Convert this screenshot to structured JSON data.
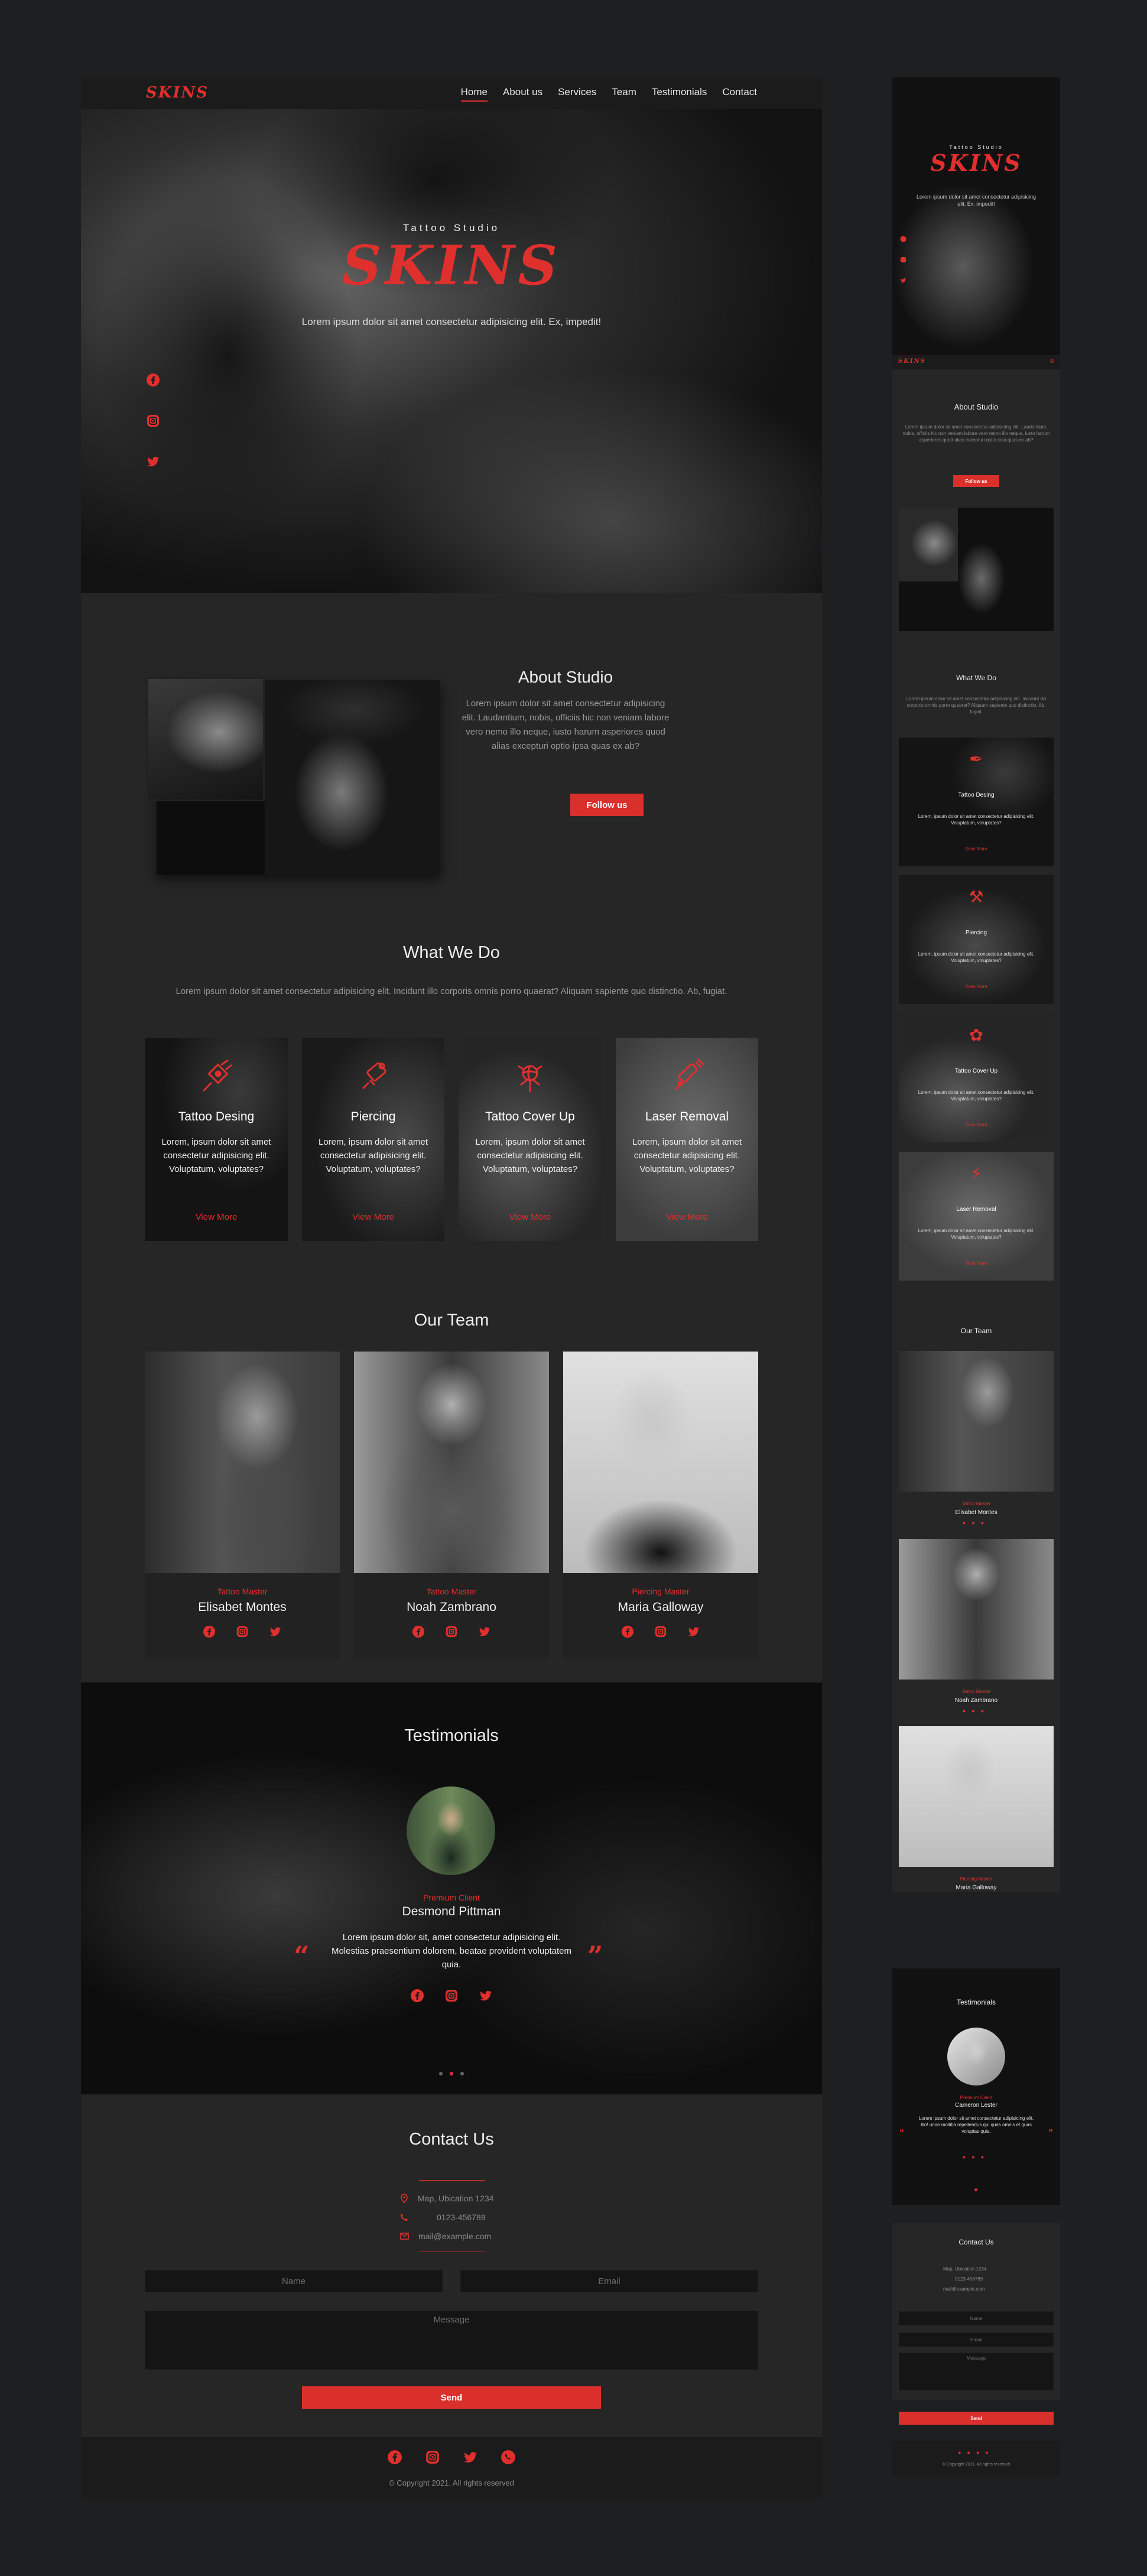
{
  "nav": {
    "logo": "SKINS",
    "items": [
      "Home",
      "About us",
      "Services",
      "Team",
      "Testimonials",
      "Contact"
    ]
  },
  "hero": {
    "kicker": "Tattoo Studio",
    "title": "SKINS",
    "subtitle": "Lorem ipsum dolor sit amet consectetur adipisicing elit. Ex, impedit!"
  },
  "about": {
    "title": "About Studio",
    "text": "Lorem ipsum dolor sit amet consectetur adipisicing elit. Laudantium, nobis, officiis hic non veniam labore vero nemo illo neque, iusto harum asperiores quod alias excepturi optio ipsa quas ex ab?",
    "button": "Follow us"
  },
  "services": {
    "title": "What We Do",
    "intro": "Lorem ipsum dolor sit amet consectetur adipisicing elit. Incidunt illo corporis omnis porro quaerat? Aliquam sapiente quo distinctio. Ab, fugiat.",
    "items": [
      {
        "title": "Tattoo Desing",
        "text": "Lorem, ipsum dolor sit amet consectetur adipisicing elit. Voluptatum, voluptates?",
        "link": "View More",
        "icon": "tattoo-machine-icon"
      },
      {
        "title": "Piercing",
        "text": "Lorem, ipsum dolor sit amet consectetur adipisicing elit. Voluptatum, voluptates?",
        "link": "View More",
        "icon": "piercing-gun-icon"
      },
      {
        "title": "Tattoo Cover Up",
        "text": "Lorem, ipsum dolor sit amet consectetur adipisicing elit. Voluptatum, voluptates?",
        "link": "View More",
        "icon": "rose-icon"
      },
      {
        "title": "Laser Removal",
        "text": "Lorem, ipsum dolor sit amet consectetur adipisicing elit. Voluptatum, voluptates?",
        "link": "View More",
        "icon": "laser-icon"
      }
    ]
  },
  "team": {
    "title": "Our Team",
    "members": [
      {
        "role": "Tattoo Master",
        "name": "Elisabet Montes"
      },
      {
        "role": "Tattoo Master",
        "name": "Noah Zambrano"
      },
      {
        "role": "Piercing Master",
        "name": "Maria Galloway"
      }
    ]
  },
  "testimonials": {
    "title": "Testimonials",
    "role": "Premium Client",
    "name": "Desmond Pittman",
    "quote": "Lorem ipsum dolor sit, amet consectetur adipisicing elit. Molestias praesentium dolorem, beatae provident voluptatem quia.",
    "mobile_role": "Premium Client",
    "mobile_name": "Cameron Lester",
    "mobile_quote": "Lorem ipsum dolor sit amet consectetur adipisicing elit. Illo! unde mollitia repellendus qui quas omnis et quas voluptas quia."
  },
  "contact": {
    "title": "Contact Us",
    "address": "Map, Ubication 1234",
    "phone": "0123-456789",
    "email": "mail@example.com",
    "name_placeholder": "Name",
    "email_placeholder": "Email",
    "message_placeholder": "Message",
    "send": "Send"
  },
  "footer": {
    "copyright": "© Copyright 2021. All rights reserved"
  },
  "colors": {
    "accent": "#e0302e",
    "bg": "#1e1f21",
    "panel": "#262626"
  }
}
